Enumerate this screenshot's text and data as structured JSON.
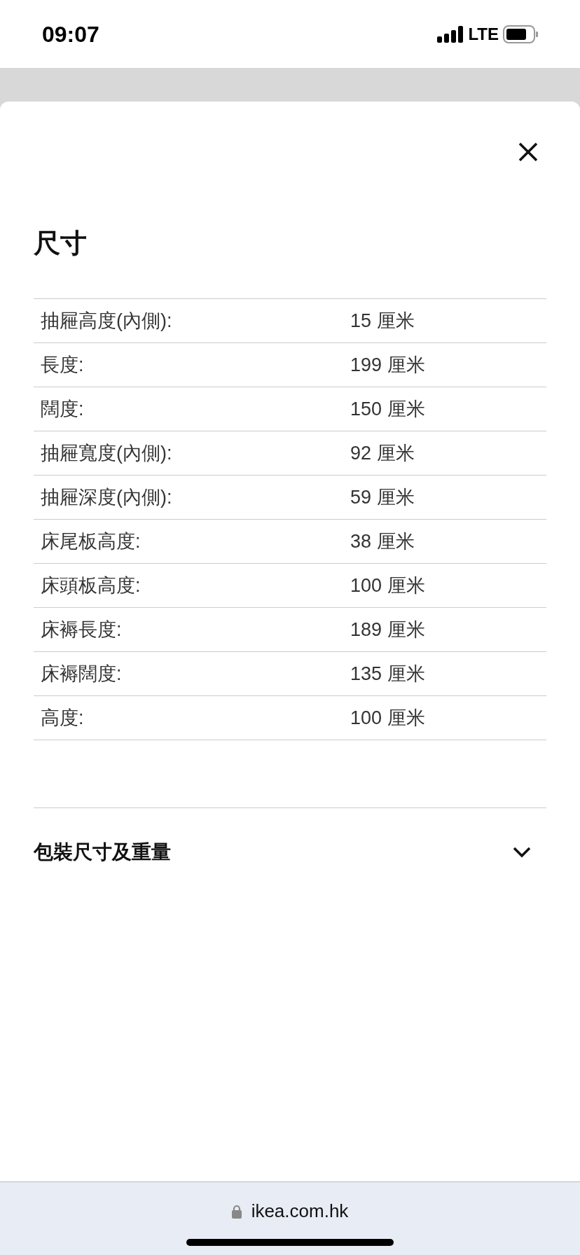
{
  "status_bar": {
    "time": "09:07",
    "network": "LTE"
  },
  "sheet": {
    "title": "尺寸",
    "rows": [
      {
        "label": "抽屜高度(內側):",
        "value": "15 厘米"
      },
      {
        "label": "長度:",
        "value": "199 厘米"
      },
      {
        "label": "闊度:",
        "value": "150 厘米"
      },
      {
        "label": "抽屜寬度(內側):",
        "value": "92 厘米"
      },
      {
        "label": "抽屜深度(內側):",
        "value": "59 厘米"
      },
      {
        "label": "床尾板高度:",
        "value": "38 厘米"
      },
      {
        "label": "床頭板高度:",
        "value": "100 厘米"
      },
      {
        "label": "床褥長度:",
        "value": "189 厘米"
      },
      {
        "label": "床褥闊度:",
        "value": "135 厘米"
      },
      {
        "label": "高度:",
        "value": "100 厘米"
      }
    ],
    "accordion": {
      "title": "包裝尺寸及重量",
      "expanded": false
    }
  },
  "browser_bar": {
    "url": "ikea.com.hk"
  }
}
